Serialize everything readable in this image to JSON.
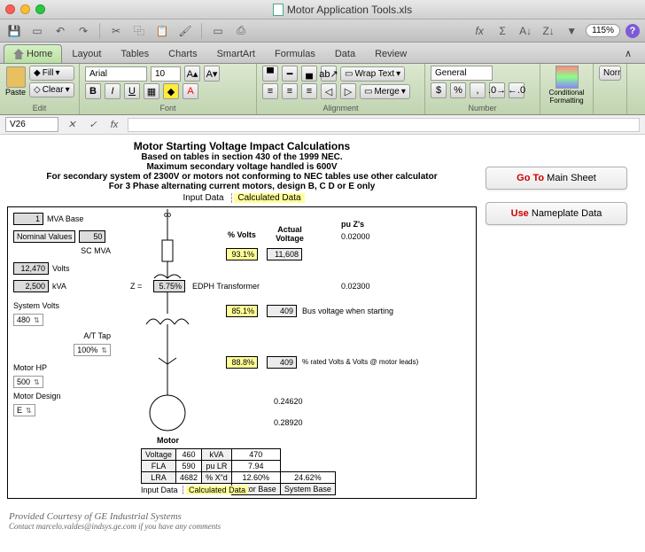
{
  "window": {
    "title": "Motor Application Tools.xls"
  },
  "quickbar": {
    "zoom": "115%"
  },
  "tabs": [
    "Home",
    "Layout",
    "Tables",
    "Charts",
    "SmartArt",
    "Formulas",
    "Data",
    "Review"
  ],
  "ribbon": {
    "groups": {
      "edit": "Edit",
      "font": "Font",
      "alignment": "Alignment",
      "number": "Number"
    },
    "fill": "Fill",
    "clear": "Clear",
    "paste": "Paste",
    "fontname": "Arial",
    "fontsize": "10",
    "wrap": "Wrap Text",
    "merge": "Merge",
    "numfmt": "General",
    "condfmt": "Conditional Formatting",
    "normal": "Norr"
  },
  "formula": {
    "cellref": "V26"
  },
  "sheet": {
    "title": "Motor Starting Voltage Impact Calculations",
    "sub1": "Based on tables in section 430 of the 1999 NEC.",
    "sub2": "Maximum secondary voltage handled is 600V",
    "sub3": "For secondary system of 2300V or motors not conforming to NEC tables use other calculator",
    "sub4": "For 3 Phase alternating current motors, design B, C D or E only",
    "legend_input": "Input Data",
    "legend_calc": "Calculated Data",
    "left": {
      "mva_base": "1",
      "mva_base_lbl": "MVA Base",
      "nominal": "Nominal Values",
      "scmva": "50",
      "scmva_lbl": "SC MVA",
      "volts": "12,470",
      "volts_lbl": "Volts",
      "kva": "2,500",
      "kva_lbl": "kVA",
      "sysvolts_lbl": "System Volts",
      "sysvolts": "480",
      "attap_lbl": "A/T Tap",
      "attap": "100%",
      "motorhp_lbl": "Motor HP",
      "motorhp": "500",
      "motordesign_lbl": "Motor Design",
      "motordesign": "E"
    },
    "mid": {
      "z_eq": "Z  =",
      "z_val": "5.75%",
      "edph": "EDPH Transformer",
      "col_pctv": "% Volts",
      "col_av": "Actual Voltage",
      "col_puz": "pu Z's",
      "r1_pct": "93.1%",
      "r1_act": "11,608",
      "r1_pu": "0.02000",
      "r2_pu": "0.02300",
      "r3_pct": "85.1%",
      "r3_act": "409",
      "r3_note": "Bus voltage when starting",
      "r4_pct": "88.8%",
      "r4_act": "409",
      "r4_note": "% rated Volts & Volts @ motor leads)",
      "r5_pu": "0.24620",
      "r6_pu": "0.28920",
      "motor_lbl": "Motor"
    },
    "mtable": {
      "h_voltage": "Voltage",
      "h_fla": "FLA",
      "h_lra": "LRA",
      "v_voltage": "460",
      "v_fla": "590",
      "v_lra": "4682",
      "h_kva": "kVA",
      "h_pulr": "pu LR",
      "h_pxd": "% X\"d",
      "v_kva": "470",
      "v_pulr": "7.94",
      "v_pxd": "12.60%",
      "v_pxd2": "24.62%",
      "h_mbase": "Motor Base",
      "h_sbase": "System Base"
    }
  },
  "sidebuttons": {
    "b1_red": "Go To ",
    "b1": "Main Sheet",
    "b2_red": "Use ",
    "b2": "Nameplate Data"
  },
  "credits": {
    "line1": "Provided Courtesy of GE Industrial Systems",
    "line2": "Contact marcelo.valdes@indsys.ge.com if you have any comments"
  }
}
